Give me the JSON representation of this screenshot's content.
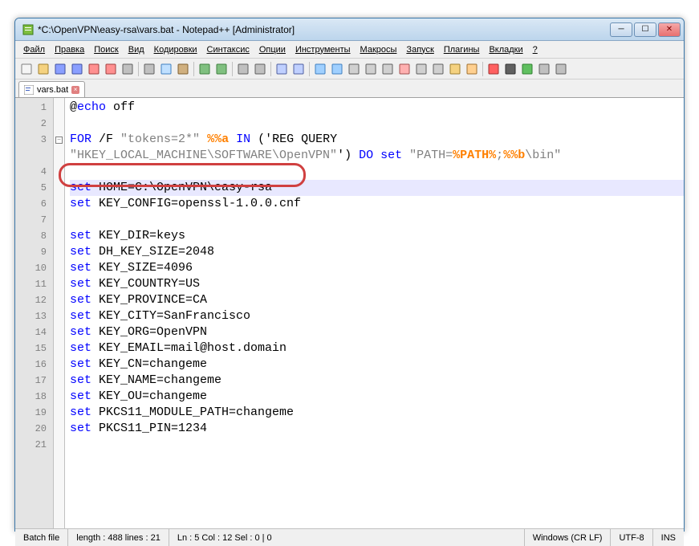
{
  "title": "*C:\\OpenVPN\\easy-rsa\\vars.bat - Notepad++ [Administrator]",
  "menus": [
    "Файл",
    "Правка",
    "Поиск",
    "Вид",
    "Кодировки",
    "Синтаксис",
    "Опции",
    "Инструменты",
    "Макросы",
    "Запуск",
    "Плагины",
    "Вкладки",
    "?"
  ],
  "tab": {
    "name": "vars.bat"
  },
  "lines": [
    {
      "n": "1",
      "seg": [
        {
          "c": "txt",
          "t": "@"
        },
        {
          "c": "kw",
          "t": "echo"
        },
        {
          "c": "txt",
          "t": " off"
        }
      ]
    },
    {
      "n": "2",
      "seg": []
    },
    {
      "n": "3",
      "seg": [
        {
          "c": "kw",
          "t": "FOR"
        },
        {
          "c": "txt",
          "t": " /F "
        },
        {
          "c": "str",
          "t": "\"tokens=2*\""
        },
        {
          "c": "txt",
          "t": " "
        },
        {
          "c": "var",
          "t": "%%a"
        },
        {
          "c": "txt",
          "t": " "
        },
        {
          "c": "kw",
          "t": "IN"
        },
        {
          "c": "txt",
          "t": " ('REG QUERY"
        }
      ]
    },
    {
      "n": "",
      "seg": [
        {
          "c": "str",
          "t": "\"HKEY_LOCAL_MACHINE\\SOFTWARE\\OpenVPN\""
        },
        {
          "c": "txt",
          "t": "') "
        },
        {
          "c": "kw",
          "t": "DO"
        },
        {
          "c": "txt",
          "t": " "
        },
        {
          "c": "kw",
          "t": "set"
        },
        {
          "c": "txt",
          "t": " "
        },
        {
          "c": "str",
          "t": "\"PATH="
        },
        {
          "c": "var",
          "t": "%PATH%"
        },
        {
          "c": "str",
          "t": ";"
        },
        {
          "c": "var",
          "t": "%%b"
        },
        {
          "c": "str",
          "t": "\\bin\""
        }
      ]
    },
    {
      "n": "4",
      "seg": []
    },
    {
      "n": "5",
      "current": true,
      "seg": [
        {
          "c": "kw",
          "t": "set"
        },
        {
          "c": "txt",
          "t": " HOME=C:\\OpenVPN\\easy-rsa"
        }
      ]
    },
    {
      "n": "6",
      "seg": [
        {
          "c": "kw",
          "t": "set"
        },
        {
          "c": "txt",
          "t": " KEY_CONFIG=openssl-1.0.0.cnf"
        }
      ],
      "strike": true
    },
    {
      "n": "7",
      "seg": []
    },
    {
      "n": "8",
      "seg": [
        {
          "c": "kw",
          "t": "set"
        },
        {
          "c": "txt",
          "t": " KEY_DIR=keys"
        }
      ]
    },
    {
      "n": "9",
      "seg": [
        {
          "c": "kw",
          "t": "set"
        },
        {
          "c": "txt",
          "t": " DH_KEY_SIZE=2048"
        }
      ]
    },
    {
      "n": "10",
      "seg": [
        {
          "c": "kw",
          "t": "set"
        },
        {
          "c": "txt",
          "t": " KEY_SIZE=4096"
        }
      ]
    },
    {
      "n": "11",
      "seg": [
        {
          "c": "kw",
          "t": "set"
        },
        {
          "c": "txt",
          "t": " KEY_COUNTRY=US"
        }
      ]
    },
    {
      "n": "12",
      "seg": [
        {
          "c": "kw",
          "t": "set"
        },
        {
          "c": "txt",
          "t": " KEY_PROVINCE=CA"
        }
      ]
    },
    {
      "n": "13",
      "seg": [
        {
          "c": "kw",
          "t": "set"
        },
        {
          "c": "txt",
          "t": " KEY_CITY=SanFrancisco"
        }
      ]
    },
    {
      "n": "14",
      "seg": [
        {
          "c": "kw",
          "t": "set"
        },
        {
          "c": "txt",
          "t": " KEY_ORG=OpenVPN"
        }
      ]
    },
    {
      "n": "15",
      "seg": [
        {
          "c": "kw",
          "t": "set"
        },
        {
          "c": "txt",
          "t": " KEY_EMAIL=mail@host.domain"
        }
      ]
    },
    {
      "n": "16",
      "seg": [
        {
          "c": "kw",
          "t": "set"
        },
        {
          "c": "txt",
          "t": " KEY_CN=changeme"
        }
      ]
    },
    {
      "n": "17",
      "seg": [
        {
          "c": "kw",
          "t": "set"
        },
        {
          "c": "txt",
          "t": " KEY_NAME=changeme"
        }
      ]
    },
    {
      "n": "18",
      "seg": [
        {
          "c": "kw",
          "t": "set"
        },
        {
          "c": "txt",
          "t": " KEY_OU=changeme"
        }
      ]
    },
    {
      "n": "19",
      "seg": [
        {
          "c": "kw",
          "t": "set"
        },
        {
          "c": "txt",
          "t": " PKCS11_MODULE_PATH=changeme"
        }
      ]
    },
    {
      "n": "20",
      "seg": [
        {
          "c": "kw",
          "t": "set"
        },
        {
          "c": "txt",
          "t": " PKCS11_PIN=1234"
        }
      ]
    },
    {
      "n": "21",
      "seg": []
    }
  ],
  "status": {
    "filetype": "Batch file",
    "length": "length : 488    lines : 21",
    "pos": "Ln : 5    Col : 12    Sel : 0 | 0",
    "eol": "Windows (CR LF)",
    "enc": "UTF-8",
    "ins": "INS"
  },
  "toolbar_icons": [
    {
      "name": "new-file-icon",
      "fill": "#f5f5f5",
      "stroke": "#808080"
    },
    {
      "name": "open-file-icon",
      "fill": "#f5d280",
      "stroke": "#a08030"
    },
    {
      "name": "save-icon",
      "fill": "#8a9fff",
      "stroke": "#4050a0"
    },
    {
      "name": "save-all-icon",
      "fill": "#8a9fff",
      "stroke": "#4050a0"
    },
    {
      "name": "close-file-icon",
      "fill": "#ff9090",
      "stroke": "#a04040"
    },
    {
      "name": "close-all-icon",
      "fill": "#ff9090",
      "stroke": "#a04040"
    },
    {
      "name": "print-icon",
      "fill": "#c0c0c0",
      "stroke": "#606060"
    },
    {
      "name": "sep"
    },
    {
      "name": "cut-icon",
      "fill": "#c0c0c0",
      "stroke": "#606060"
    },
    {
      "name": "copy-icon",
      "fill": "#c0e0ff",
      "stroke": "#4080c0"
    },
    {
      "name": "paste-icon",
      "fill": "#d0b080",
      "stroke": "#806030"
    },
    {
      "name": "sep"
    },
    {
      "name": "undo-icon",
      "fill": "#80c080",
      "stroke": "#408040"
    },
    {
      "name": "redo-icon",
      "fill": "#80c080",
      "stroke": "#408040"
    },
    {
      "name": "sep"
    },
    {
      "name": "find-icon",
      "fill": "#c0c0c0",
      "stroke": "#606060"
    },
    {
      "name": "replace-icon",
      "fill": "#c0c0c0",
      "stroke": "#606060"
    },
    {
      "name": "sep"
    },
    {
      "name": "zoom-in-icon",
      "fill": "#c0d0ff",
      "stroke": "#5060a0"
    },
    {
      "name": "zoom-out-icon",
      "fill": "#c0d0ff",
      "stroke": "#5060a0"
    },
    {
      "name": "sep"
    },
    {
      "name": "sync-v-icon",
      "fill": "#a0d0ff",
      "stroke": "#4080c0"
    },
    {
      "name": "sync-h-icon",
      "fill": "#a0d0ff",
      "stroke": "#4080c0"
    },
    {
      "name": "word-wrap-icon",
      "fill": "#d0d0d0",
      "stroke": "#606060"
    },
    {
      "name": "all-chars-icon",
      "fill": "#d0d0d0",
      "stroke": "#606060"
    },
    {
      "name": "indent-guide-icon",
      "fill": "#d0d0d0",
      "stroke": "#606060"
    },
    {
      "name": "lang-icon",
      "fill": "#ffb0b0",
      "stroke": "#a05050"
    },
    {
      "name": "doc-map-icon",
      "fill": "#d0d0d0",
      "stroke": "#606060"
    },
    {
      "name": "func-list-icon",
      "fill": "#d0d0d0",
      "stroke": "#606060"
    },
    {
      "name": "folder-view-icon",
      "fill": "#f5d280",
      "stroke": "#a08030"
    },
    {
      "name": "monitor-icon",
      "fill": "#ffd090",
      "stroke": "#a07030"
    },
    {
      "name": "sep"
    },
    {
      "name": "record-macro-icon",
      "fill": "#ff6060",
      "stroke": "#a03030"
    },
    {
      "name": "stop-macro-icon",
      "fill": "#606060",
      "stroke": "#303030"
    },
    {
      "name": "play-macro-icon",
      "fill": "#60c060",
      "stroke": "#308030"
    },
    {
      "name": "run-macro-icon",
      "fill": "#c0c0c0",
      "stroke": "#606060"
    },
    {
      "name": "save-macro-icon",
      "fill": "#c0c0c0",
      "stroke": "#606060"
    }
  ]
}
